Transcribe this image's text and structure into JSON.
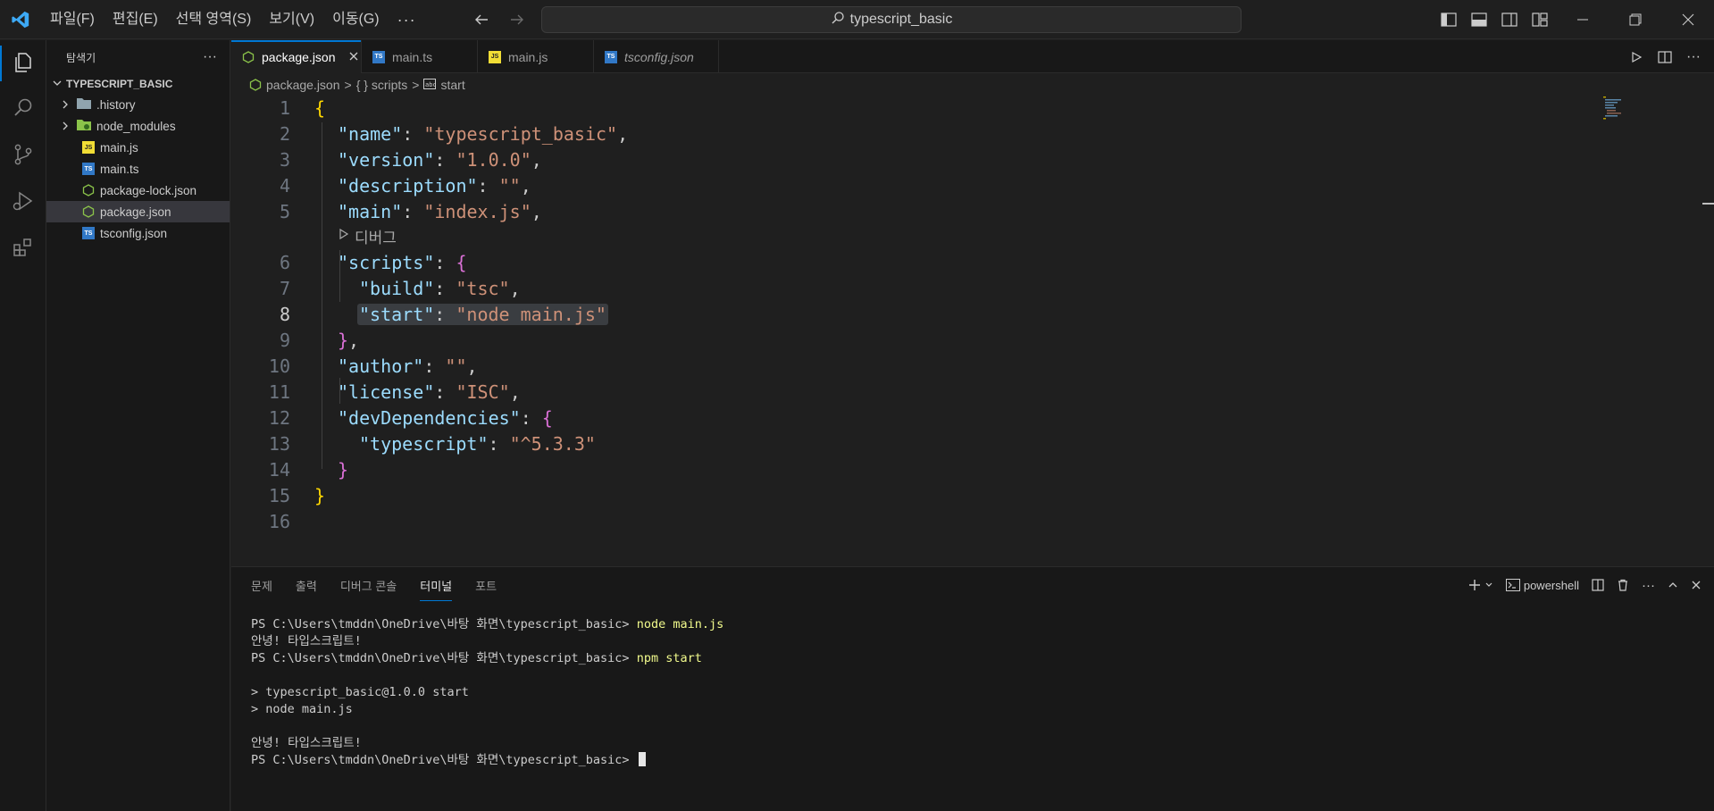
{
  "menu": {
    "items": [
      "파일(F)",
      "편집(E)",
      "선택 영역(S)",
      "보기(V)",
      "이동(G)"
    ],
    "more": "···"
  },
  "search": {
    "text": "typescript_basic"
  },
  "explorer": {
    "title": "탐색기",
    "more": "···",
    "folder": "TYPESCRIPT_BASIC",
    "items": [
      ".history",
      "node_modules",
      "main.js",
      "main.ts",
      "package-lock.json",
      "package.json",
      "tsconfig.json"
    ]
  },
  "tabs": [
    "package.json",
    "main.ts",
    "main.js",
    "tsconfig.json"
  ],
  "breadcrumb": {
    "file": "package.json",
    "sep": ">",
    "scope": "{ } scripts",
    "item": "start"
  },
  "editor": {
    "line_numbers": [
      "1",
      "2",
      "3",
      "4",
      "5",
      "6",
      "7",
      "8",
      "9",
      "10",
      "11",
      "12",
      "13",
      "14",
      "15",
      "16"
    ],
    "codelens": "디버그",
    "lines": {
      "l1_brace": "{",
      "l2_key": "\"name\"",
      "l2_val": "\"typescript_basic\"",
      "l3_key": "\"version\"",
      "l3_val": "\"1.0.0\"",
      "l4_key": "\"description\"",
      "l4_val": "\"\"",
      "l5_key": "\"main\"",
      "l5_val": "\"index.js\"",
      "l6_key": "\"scripts\"",
      "l6_brace": "{",
      "l7_key": "\"build\"",
      "l7_val": "\"tsc\"",
      "l8_key": "\"start\"",
      "l8_val": "\"node main.js\"",
      "l9_brace": "}",
      "l10_key": "\"author\"",
      "l10_val": "\"\"",
      "l11_key": "\"license\"",
      "l11_val": "\"ISC\"",
      "l12_key": "\"devDependencies\"",
      "l12_brace": "{",
      "l13_key": "\"typescript\"",
      "l13_val": "\"^5.3.3\"",
      "l14_brace": "}",
      "l15_brace": "}"
    }
  },
  "panel": {
    "tabs": [
      "문제",
      "출력",
      "디버그 콘솔",
      "터미널",
      "포트"
    ],
    "shell": "powershell",
    "terminal": {
      "prompt": "PS C:\\Users\\tmddn\\OneDrive\\바탕 화면\\typescript_basic> ",
      "cmd1": "node main.js",
      "out1": "안녕! 타입스크립트!",
      "cmd2": "npm start",
      "out2": "> typescript_basic@1.0.0 start",
      "out3": "> node main.js",
      "out4": "안녕! 타입스크립트!"
    }
  },
  "colors": {
    "accent": "#0078d4",
    "json_icon": "#8bc34a",
    "js_icon": "#f1dd35",
    "ts_icon": "#3178c6"
  }
}
